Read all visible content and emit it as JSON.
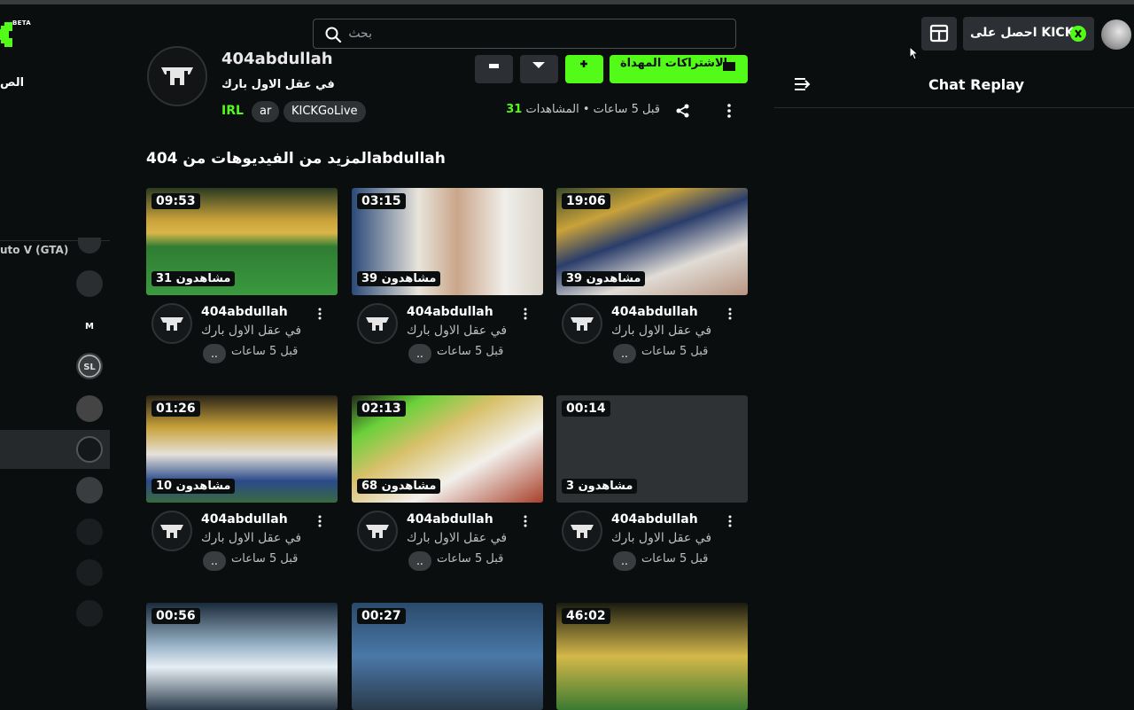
{
  "header": {
    "logo_badge": "BETA",
    "search_placeholder": "بحث",
    "kicks_label": "احصل على KICKs"
  },
  "sidebar": {
    "fragment_label": "الص",
    "gta_label": "uto V (GTA)"
  },
  "channel": {
    "name": "404abdullah",
    "stream_title": "في عقل الاول بارك",
    "category": "IRL",
    "tags": [
      "ar",
      "KICKGoLive"
    ],
    "gift_button_label": "الاشتراكات المهداة",
    "time_ago": "قبل 5 ساعات",
    "views_label": "المشاهدات",
    "views_count": "31"
  },
  "more_videos_heading": "المزيد من الفيديوهات من 404abdullah",
  "videos": [
    {
      "duration": "09:53",
      "views": "31 مشاهدون",
      "channel": "404abdullah",
      "title": "في عقل الاول بارك",
      "chip": "..",
      "time": "قبل 5 ساعات"
    },
    {
      "duration": "03:15",
      "views": "39 مشاهدون",
      "channel": "404abdullah",
      "title": "في عقل الاول بارك",
      "chip": "..",
      "time": "قبل 5 ساعات"
    },
    {
      "duration": "19:06",
      "views": "39 مشاهدون",
      "channel": "404abdullah",
      "title": "في عقل الاول بارك",
      "chip": "..",
      "time": "قبل 5 ساعات"
    },
    {
      "duration": "01:26",
      "views": "10 مشاهدون",
      "channel": "404abdullah",
      "title": "في عقل الاول بارك",
      "chip": "..",
      "time": "قبل 5 ساعات"
    },
    {
      "duration": "02:13",
      "views": "68 مشاهدون",
      "channel": "404abdullah",
      "title": "في عقل الاول بارك",
      "chip": "..",
      "time": "قبل 5 ساعات"
    },
    {
      "duration": "00:14",
      "views": "3 مشاهدون",
      "channel": "404abdullah",
      "title": "في عقل الاول بارك",
      "chip": "..",
      "time": "قبل 5 ساعات"
    },
    {
      "duration": "00:56"
    },
    {
      "duration": "00:27"
    },
    {
      "duration": "46:02"
    }
  ],
  "chat": {
    "title": "Chat Replay"
  },
  "colors": {
    "accent": "#53fc18",
    "background": "#0b0e0f",
    "surface": "#2c2f33"
  }
}
